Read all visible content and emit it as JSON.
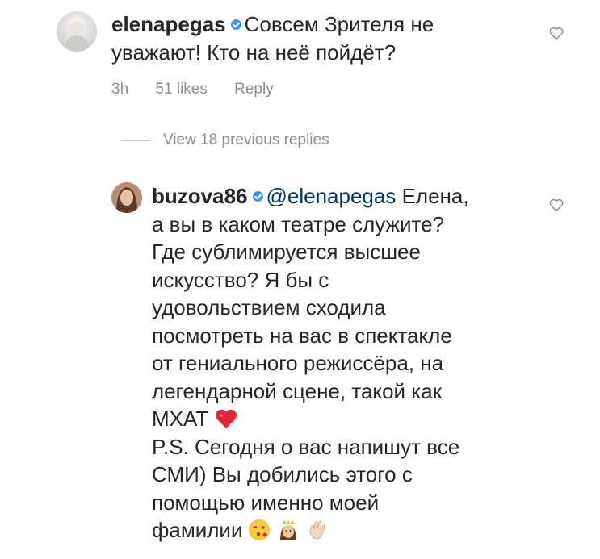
{
  "comment1": {
    "username": "elenapegas",
    "text": "Совсем Зрителя не уважают! Кто на неё пойдёт?",
    "time": "3h",
    "likes": "51 likes",
    "reply_label": "Reply"
  },
  "view_replies": "View 18 previous replies",
  "comment2": {
    "username": "buzova86",
    "mention": "@elenapegas",
    "line1_rest": " Елена,",
    "lines": [
      "а вы в каком театре служите?",
      "Где сублимируется высшее",
      "искусство? Я бы с",
      "удовольствием сходила",
      "посмотреть на вас в спектакле",
      "от гениального режиссёра, на",
      "легендарной сцене, такой как"
    ],
    "mhat": "МХАТ",
    "ps_lines": [
      "P.S. Сегодня о вас напишут все",
      "СМИ) Вы добились этого с",
      "помощью именно моей"
    ],
    "last_line": "фамилии"
  },
  "icons": [
    "heart-outline-icon",
    "verified-badge-icon",
    "red-heart-emoji",
    "kissing-face-emoji",
    "princess-emoji",
    "waving-hand-emoji"
  ],
  "colors": {
    "verified": "#3897f0",
    "mention": "#00376b",
    "meta": "#8e8e8e"
  }
}
